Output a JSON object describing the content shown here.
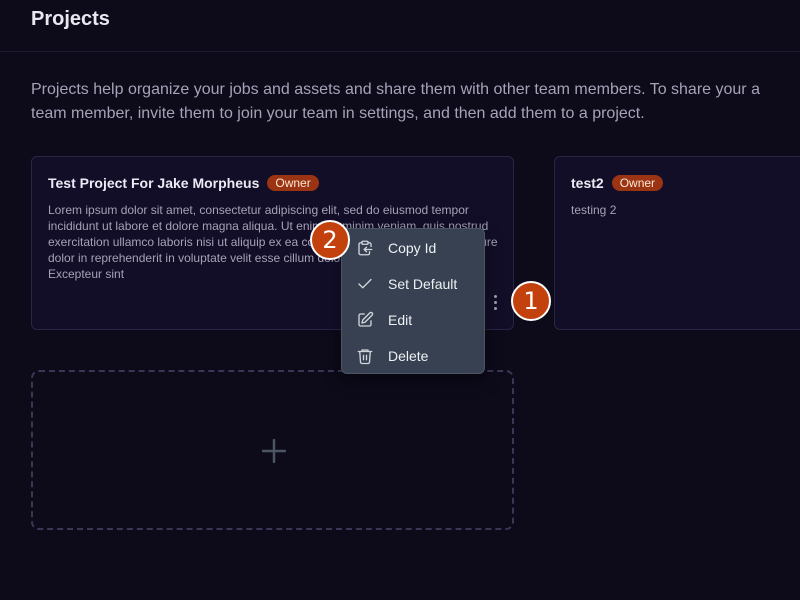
{
  "page": {
    "title": "Projects",
    "intro_line1": "Projects help organize your jobs and assets and share them with other team members. To share your a",
    "intro_line2": "team member, invite them to join your team in settings, and then add them to a project."
  },
  "projects": [
    {
      "title": "Test Project For Jake Morpheus",
      "badge": "Owner",
      "description": "Lorem ipsum dolor sit amet, consectetur adipiscing elit, sed do eiusmod tempor incididunt ut labore et dolore magna aliqua. Ut enim ad minim veniam, quis nostrud exercitation ullamco laboris nisi ut aliquip ex ea commodo consequat. Duis aute irure dolor in reprehenderit in voluptate velit esse cillum dolore eu fugiat nulla pariatur. Excepteur sint"
    },
    {
      "title": "test2",
      "badge": "Owner",
      "description": "testing 2"
    }
  ],
  "context_menu": {
    "items": [
      {
        "label": "Copy Id",
        "icon": "copy-id-icon"
      },
      {
        "label": "Set Default",
        "icon": "check-icon"
      },
      {
        "label": "Edit",
        "icon": "edit-icon"
      },
      {
        "label": "Delete",
        "icon": "trash-icon"
      }
    ]
  },
  "add_project": {
    "icon": "plus-icon"
  },
  "step_markers": [
    "1",
    "2"
  ],
  "colors": {
    "background": "#0d0a1a",
    "card": "#130e28",
    "badge": "#9a3412",
    "menu": "#374151",
    "marker": "#c2410c"
  }
}
